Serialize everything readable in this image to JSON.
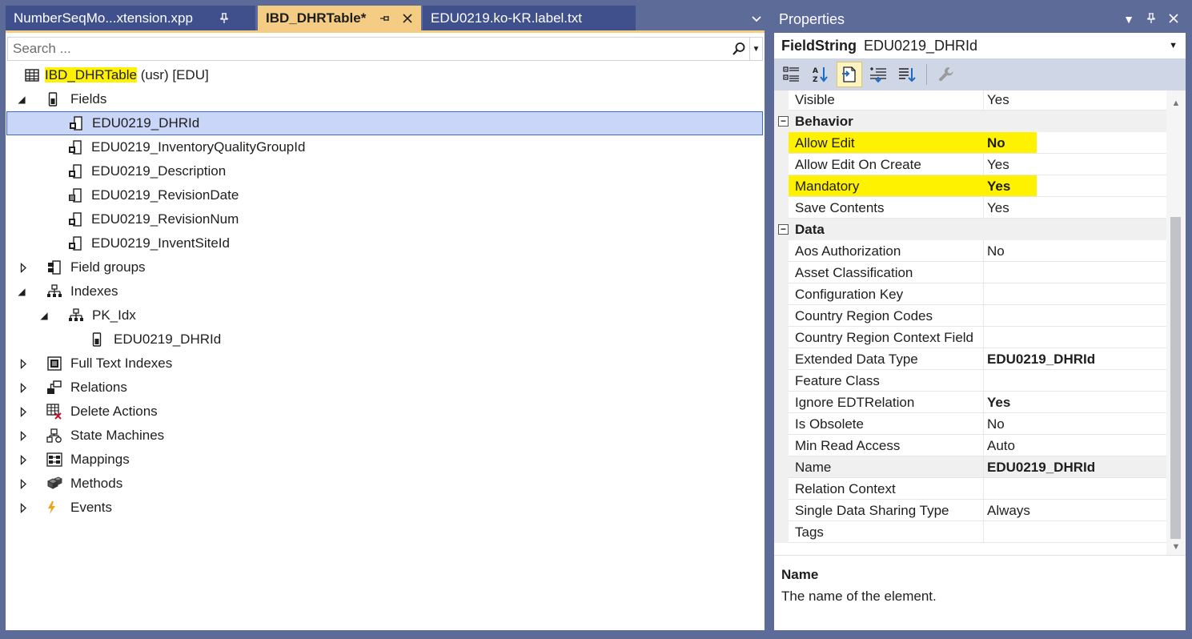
{
  "tabs": [
    {
      "label": "NumberSeqMo...xtension.xpp",
      "active": false
    },
    {
      "label": "IBD_DHRTable*",
      "active": true
    },
    {
      "label": "EDU0219.ko-KR.label.txt",
      "active": false
    }
  ],
  "search": {
    "placeholder": "Search ...",
    "value": ""
  },
  "tree": {
    "root": {
      "name": "IBD_DHRTable",
      "suffix": " (usr) [EDU]"
    },
    "fields_label": "Fields",
    "fields": [
      "EDU0219_DHRId",
      "EDU0219_InventoryQualityGroupId",
      "EDU0219_Description",
      "EDU0219_RevisionDate",
      "EDU0219_RevisionNum",
      "EDU0219_InventSiteId"
    ],
    "field_groups_label": "Field groups",
    "indexes_label": "Indexes",
    "index_name": "PK_Idx",
    "index_field": "EDU0219_DHRId",
    "full_text_indexes_label": "Full Text Indexes",
    "relations_label": "Relations",
    "delete_actions_label": "Delete Actions",
    "state_machines_label": "State Machines",
    "mappings_label": "Mappings",
    "methods_label": "Methods",
    "events_label": "Events"
  },
  "properties": {
    "title": "Properties",
    "object_type": "FieldString",
    "object_name": "EDU0219_DHRId",
    "rows": [
      {
        "name": "Visible",
        "value": "Yes"
      },
      {
        "category": "Behavior"
      },
      {
        "name": "Allow Edit",
        "value": "No",
        "bold": true,
        "highlight": true
      },
      {
        "name": "Allow Edit On Create",
        "value": "Yes"
      },
      {
        "name": "Mandatory",
        "value": "Yes",
        "bold": true,
        "highlight": true
      },
      {
        "name": "Save Contents",
        "value": "Yes"
      },
      {
        "category": "Data"
      },
      {
        "name": "Aos Authorization",
        "value": "No"
      },
      {
        "name": "Asset Classification",
        "value": ""
      },
      {
        "name": "Configuration Key",
        "value": ""
      },
      {
        "name": "Country Region Codes",
        "value": ""
      },
      {
        "name": "Country Region Context Field",
        "value": ""
      },
      {
        "name": "Extended Data Type",
        "value": "EDU0219_DHRId",
        "bold": true
      },
      {
        "name": "Feature Class",
        "value": ""
      },
      {
        "name": "Ignore EDTRelation",
        "value": "Yes",
        "bold": true
      },
      {
        "name": "Is Obsolete",
        "value": "No"
      },
      {
        "name": "Min Read Access",
        "value": "Auto"
      },
      {
        "name": "Name",
        "value": "EDU0219_DHRId",
        "bold": true,
        "selected": true
      },
      {
        "name": "Relation Context",
        "value": ""
      },
      {
        "name": "Single Data Sharing Type",
        "value": "Always"
      },
      {
        "name": "Tags",
        "value": ""
      }
    ],
    "description": {
      "title": "Name",
      "text": "The name of the element."
    }
  }
}
